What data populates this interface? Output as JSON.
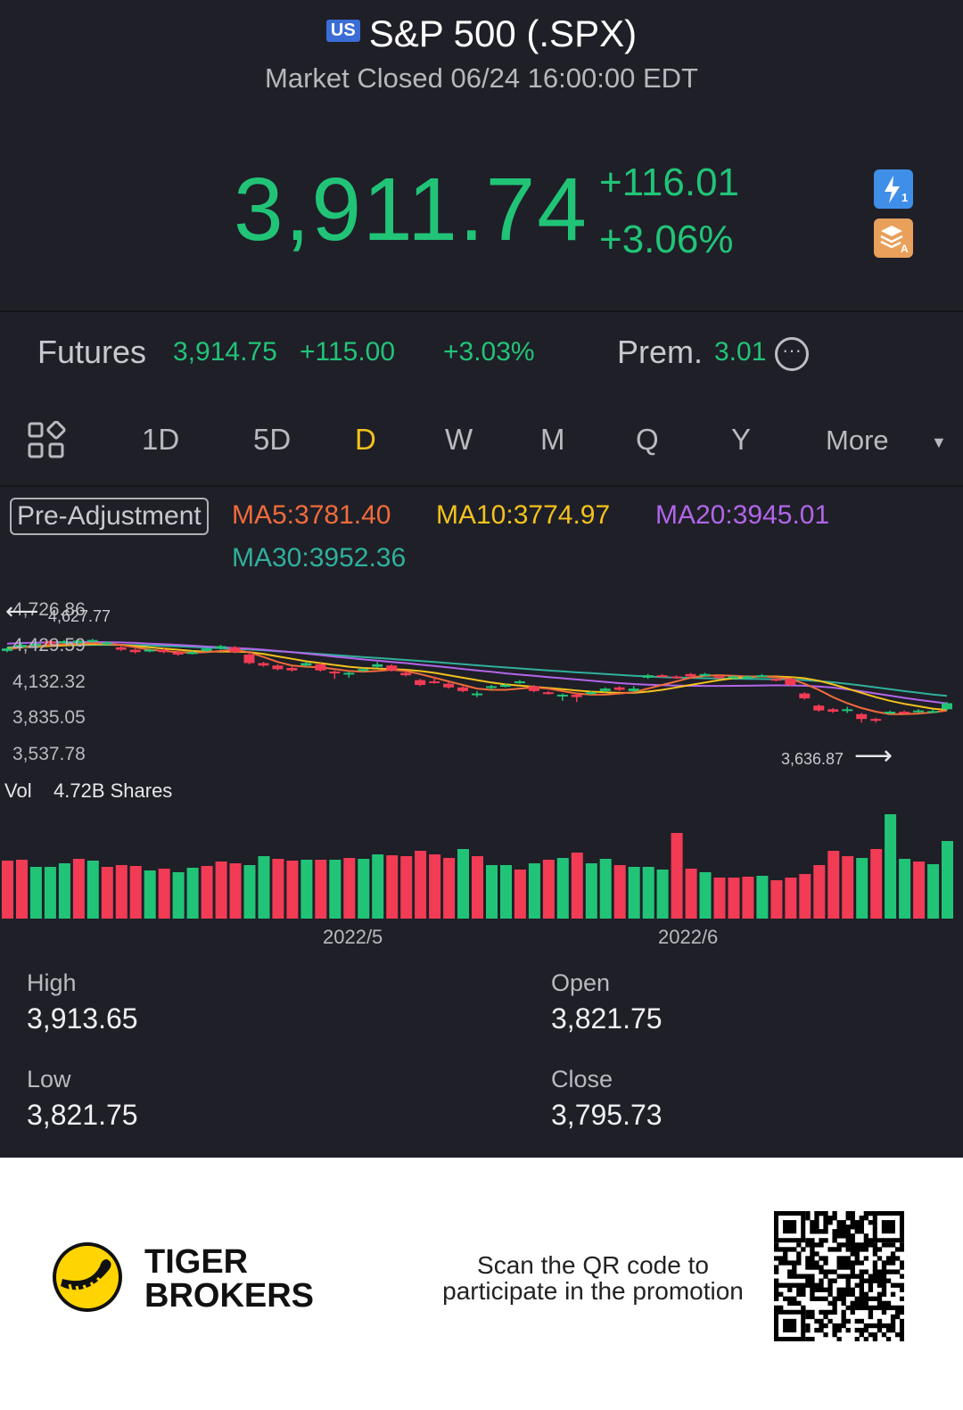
{
  "header": {
    "badge": "US",
    "title": "S&P 500 (.SPX)",
    "status": "Market Closed 06/24 16:00:00 EDT"
  },
  "quote": {
    "price": "3,911.74",
    "change": "+116.01",
    "change_pct": "+3.06%",
    "up_color": "#21c477",
    "down_color": "#f23b54"
  },
  "futures": {
    "label": "Futures",
    "price": "3,914.75",
    "change": "+115.00",
    "change_pct": "+3.03%",
    "prem_label": "Prem.",
    "prem_value": "3.01"
  },
  "tabs": {
    "items": [
      "1D",
      "5D",
      "D",
      "W",
      "M",
      "Q",
      "Y"
    ],
    "active": "D",
    "more_label": "More"
  },
  "indicators": {
    "adjust_label": "Pre-Adjustment",
    "ma5": "MA5:3781.40",
    "ma10": "MA10:3774.97",
    "ma20": "MA20:3945.01",
    "ma30": "MA30:3952.36"
  },
  "chart_data": {
    "type": "candlestick",
    "y_ticks": [
      "4,726.86",
      "4,429.59",
      "4,132.32",
      "3,835.05",
      "3,537.78"
    ],
    "max_annotation": "4,627.77",
    "min_annotation": "3,636.87",
    "x_ticks": [
      "2022/5",
      "2022/6"
    ],
    "volume_label": "Vol",
    "volume_value": "4.72B Shares",
    "candles": [
      {
        "o": 4390,
        "c": 4410,
        "h": 4420,
        "l": 4380
      },
      {
        "o": 4420,
        "c": 4440,
        "h": 4460,
        "l": 4410
      },
      {
        "o": 4430,
        "c": 4450,
        "h": 4460,
        "l": 4420
      },
      {
        "o": 4470,
        "c": 4450,
        "h": 4480,
        "l": 4440
      },
      {
        "o": 4460,
        "c": 4470,
        "h": 4480,
        "l": 4450
      },
      {
        "o": 4455,
        "c": 4475,
        "h": 4485,
        "l": 4445
      },
      {
        "o": 4470,
        "c": 4480,
        "h": 4490,
        "l": 4460
      },
      {
        "o": 4450,
        "c": 4460,
        "h": 4470,
        "l": 4440
      },
      {
        "o": 4420,
        "c": 4400,
        "h": 4430,
        "l": 4390
      },
      {
        "o": 4400,
        "c": 4380,
        "h": 4410,
        "l": 4370
      },
      {
        "o": 4390,
        "c": 4400,
        "h": 4410,
        "l": 4380
      },
      {
        "o": 4400,
        "c": 4380,
        "h": 4410,
        "l": 4370
      },
      {
        "o": 4380,
        "c": 4360,
        "h": 4395,
        "l": 4350
      },
      {
        "o": 4370,
        "c": 4380,
        "h": 4390,
        "l": 4360
      },
      {
        "o": 4390,
        "c": 4410,
        "h": 4420,
        "l": 4380
      },
      {
        "o": 4410,
        "c": 4430,
        "h": 4440,
        "l": 4400
      },
      {
        "o": 4420,
        "c": 4380,
        "h": 4430,
        "l": 4370
      },
      {
        "o": 4360,
        "c": 4290,
        "h": 4370,
        "l": 4280
      },
      {
        "o": 4290,
        "c": 4270,
        "h": 4300,
        "l": 4260
      },
      {
        "o": 4270,
        "c": 4240,
        "h": 4280,
        "l": 4230
      },
      {
        "o": 4250,
        "c": 4230,
        "h": 4260,
        "l": 4220
      },
      {
        "o": 4270,
        "c": 4290,
        "h": 4300,
        "l": 4260
      },
      {
        "o": 4280,
        "c": 4230,
        "h": 4290,
        "l": 4220
      },
      {
        "o": 4220,
        "c": 4210,
        "h": 4230,
        "l": 4160
      },
      {
        "o": 4200,
        "c": 4210,
        "h": 4220,
        "l": 4170
      },
      {
        "o": 4230,
        "c": 4240,
        "h": 4250,
        "l": 4220
      },
      {
        "o": 4260,
        "c": 4280,
        "h": 4300,
        "l": 4250
      },
      {
        "o": 4270,
        "c": 4230,
        "h": 4280,
        "l": 4220
      },
      {
        "o": 4210,
        "c": 4190,
        "h": 4220,
        "l": 4180
      },
      {
        "o": 4150,
        "c": 4110,
        "h": 4160,
        "l": 4100
      },
      {
        "o": 4140,
        "c": 4130,
        "h": 4180,
        "l": 4120
      },
      {
        "o": 4120,
        "c": 4090,
        "h": 4130,
        "l": 4080
      },
      {
        "o": 4090,
        "c": 4060,
        "h": 4100,
        "l": 4050
      },
      {
        "o": 4030,
        "c": 4040,
        "h": 4060,
        "l": 4010
      },
      {
        "o": 4090,
        "c": 4100,
        "h": 4110,
        "l": 4070
      },
      {
        "o": 4100,
        "c": 4110,
        "h": 4120,
        "l": 4090
      },
      {
        "o": 4130,
        "c": 4140,
        "h": 4150,
        "l": 4120
      },
      {
        "o": 4100,
        "c": 4060,
        "h": 4110,
        "l": 4050
      },
      {
        "o": 4050,
        "c": 4040,
        "h": 4060,
        "l": 4030
      },
      {
        "o": 4020,
        "c": 4030,
        "h": 4040,
        "l": 3980
      },
      {
        "o": 4030,
        "c": 4010,
        "h": 4040,
        "l": 3970
      },
      {
        "o": 4040,
        "c": 4050,
        "h": 4060,
        "l": 4030
      },
      {
        "o": 4060,
        "c": 4080,
        "h": 4090,
        "l": 4050
      },
      {
        "o": 4090,
        "c": 4070,
        "h": 4100,
        "l": 4060
      },
      {
        "o": 4060,
        "c": 4080,
        "h": 4100,
        "l": 4050
      },
      {
        "o": 4170,
        "c": 4190,
        "h": 4200,
        "l": 4160
      },
      {
        "o": 4190,
        "c": 4180,
        "h": 4200,
        "l": 4170
      },
      {
        "o": 4180,
        "c": 4170,
        "h": 4190,
        "l": 4160
      },
      {
        "o": 4200,
        "c": 4180,
        "h": 4210,
        "l": 4170
      },
      {
        "o": 4190,
        "c": 4200,
        "h": 4210,
        "l": 4180
      },
      {
        "o": 4180,
        "c": 4170,
        "h": 4190,
        "l": 4160
      },
      {
        "o": 4175,
        "c": 4180,
        "h": 4190,
        "l": 4160
      },
      {
        "o": 4170,
        "c": 4180,
        "h": 4190,
        "l": 4160
      },
      {
        "o": 4180,
        "c": 4190,
        "h": 4200,
        "l": 4170
      },
      {
        "o": 4160,
        "c": 4150,
        "h": 4170,
        "l": 4140
      },
      {
        "o": 4160,
        "c": 4110,
        "h": 4170,
        "l": 4100
      },
      {
        "o": 4040,
        "c": 4000,
        "h": 4050,
        "l": 3990
      },
      {
        "o": 3940,
        "c": 3900,
        "h": 3950,
        "l": 3890
      },
      {
        "o": 3910,
        "c": 3890,
        "h": 3920,
        "l": 3880
      },
      {
        "o": 3900,
        "c": 3910,
        "h": 3930,
        "l": 3880
      },
      {
        "o": 3870,
        "c": 3830,
        "h": 3880,
        "l": 3800
      },
      {
        "o": 3830,
        "c": 3820,
        "h": 3840,
        "l": 3800
      },
      {
        "o": 3880,
        "c": 3890,
        "h": 3900,
        "l": 3870
      },
      {
        "o": 3890,
        "c": 3880,
        "h": 3900,
        "l": 3870
      },
      {
        "o": 3890,
        "c": 3900,
        "h": 3910,
        "l": 3880
      },
      {
        "o": 3890,
        "c": 3895,
        "h": 3910,
        "l": 3880
      },
      {
        "o": 3910,
        "c": 3960,
        "h": 3970,
        "l": 3900
      }
    ],
    "ma5": [
      4400,
      4420,
      4430,
      4440,
      4445,
      4450,
      4455,
      4450,
      4440,
      4420,
      4400,
      4390,
      4380,
      4375,
      4380,
      4390,
      4400,
      4380,
      4340,
      4300,
      4270,
      4260,
      4255,
      4240,
      4225,
      4220,
      4225,
      4235,
      4225,
      4200,
      4170,
      4140,
      4110,
      4080,
      4070,
      4070,
      4080,
      4090,
      4080,
      4060,
      4040,
      4030,
      4030,
      4040,
      4050,
      4080,
      4110,
      4140,
      4170,
      4185,
      4190,
      4185,
      4180,
      4180,
      4175,
      4160,
      4120,
      4070,
      4010,
      3960,
      3920,
      3890,
      3870,
      3870,
      3875,
      3885,
      3900
    ],
    "ma10": [
      4410,
      4420,
      4425,
      4430,
      4435,
      4440,
      4445,
      4445,
      4440,
      4430,
      4420,
      4410,
      4400,
      4390,
      4385,
      4385,
      4385,
      4380,
      4365,
      4345,
      4325,
      4305,
      4290,
      4275,
      4260,
      4250,
      4245,
      4240,
      4235,
      4225,
      4210,
      4190,
      4170,
      4150,
      4130,
      4115,
      4105,
      4095,
      4085,
      4075,
      4065,
      4055,
      4050,
      4045,
      4045,
      4055,
      4070,
      4090,
      4110,
      4130,
      4150,
      4165,
      4175,
      4180,
      4180,
      4175,
      4165,
      4145,
      4115,
      4080,
      4045,
      4010,
      3980,
      3955,
      3935,
      3915,
      3905
    ],
    "ma20": [
      4450,
      4455,
      4458,
      4460,
      4462,
      4463,
      4463,
      4462,
      4460,
      4456,
      4450,
      4445,
      4440,
      4433,
      4426,
      4420,
      4414,
      4408,
      4400,
      4390,
      4380,
      4368,
      4356,
      4344,
      4332,
      4320,
      4310,
      4300,
      4290,
      4278,
      4266,
      4254,
      4242,
      4230,
      4218,
      4206,
      4195,
      4185,
      4175,
      4165,
      4155,
      4145,
      4135,
      4125,
      4118,
      4112,
      4108,
      4105,
      4103,
      4102,
      4102,
      4103,
      4104,
      4106,
      4107,
      4106,
      4104,
      4098,
      4088,
      4074,
      4058,
      4040,
      4022,
      4004,
      3988,
      3972,
      3958
    ],
    "ma30": [
      4420,
      4425,
      4430,
      4433,
      4436,
      4438,
      4440,
      4440,
      4440,
      4438,
      4436,
      4432,
      4428,
      4423,
      4418,
      4413,
      4408,
      4402,
      4396,
      4388,
      4380,
      4372,
      4364,
      4356,
      4348,
      4340,
      4332,
      4324,
      4316,
      4308,
      4299,
      4290,
      4281,
      4272,
      4263,
      4254,
      4246,
      4238,
      4230,
      4222,
      4214,
      4207,
      4200,
      4193,
      4186,
      4180,
      4175,
      4171,
      4168,
      4165,
      4163,
      4161,
      4160,
      4159,
      4157,
      4155,
      4150,
      4142,
      4132,
      4120,
      4106,
      4090,
      4075,
      4060,
      4046,
      4032,
      4020
    ],
    "volumes": [
      {
        "v": 65,
        "up": false
      },
      {
        "v": 66,
        "up": false
      },
      {
        "v": 58,
        "up": true
      },
      {
        "v": 58,
        "up": true
      },
      {
        "v": 62,
        "up": true
      },
      {
        "v": 67,
        "up": false
      },
      {
        "v": 65,
        "up": true
      },
      {
        "v": 58,
        "up": false
      },
      {
        "v": 60,
        "up": false
      },
      {
        "v": 59,
        "up": false
      },
      {
        "v": 54,
        "up": true
      },
      {
        "v": 56,
        "up": false
      },
      {
        "v": 52,
        "up": true
      },
      {
        "v": 57,
        "up": true
      },
      {
        "v": 59,
        "up": false
      },
      {
        "v": 64,
        "up": false
      },
      {
        "v": 62,
        "up": false
      },
      {
        "v": 60,
        "up": true
      },
      {
        "v": 70,
        "up": true
      },
      {
        "v": 67,
        "up": false
      },
      {
        "v": 65,
        "up": false
      },
      {
        "v": 66,
        "up": true
      },
      {
        "v": 66,
        "up": false
      },
      {
        "v": 66,
        "up": true
      },
      {
        "v": 68,
        "up": false
      },
      {
        "v": 67,
        "up": true
      },
      {
        "v": 72,
        "up": true
      },
      {
        "v": 71,
        "up": false
      },
      {
        "v": 70,
        "up": false
      },
      {
        "v": 76,
        "up": false
      },
      {
        "v": 72,
        "up": false
      },
      {
        "v": 68,
        "up": false
      },
      {
        "v": 78,
        "up": true
      },
      {
        "v": 70,
        "up": false
      },
      {
        "v": 60,
        "up": true
      },
      {
        "v": 60,
        "up": true
      },
      {
        "v": 55,
        "up": false
      },
      {
        "v": 62,
        "up": true
      },
      {
        "v": 66,
        "up": false
      },
      {
        "v": 68,
        "up": true
      },
      {
        "v": 74,
        "up": false
      },
      {
        "v": 62,
        "up": true
      },
      {
        "v": 67,
        "up": true
      },
      {
        "v": 60,
        "up": false
      },
      {
        "v": 58,
        "up": true
      },
      {
        "v": 58,
        "up": true
      },
      {
        "v": 55,
        "up": true
      },
      {
        "v": 96,
        "up": false
      },
      {
        "v": 56,
        "up": false
      },
      {
        "v": 52,
        "up": true
      },
      {
        "v": 46,
        "up": false
      },
      {
        "v": 46,
        "up": false
      },
      {
        "v": 47,
        "up": false
      },
      {
        "v": 48,
        "up": true
      },
      {
        "v": 43,
        "up": false
      },
      {
        "v": 46,
        "up": false
      },
      {
        "v": 50,
        "up": false
      },
      {
        "v": 60,
        "up": false
      },
      {
        "v": 76,
        "up": false
      },
      {
        "v": 70,
        "up": false
      },
      {
        "v": 68,
        "up": true
      },
      {
        "v": 78,
        "up": false
      },
      {
        "v": 117,
        "up": true
      },
      {
        "v": 67,
        "up": true
      },
      {
        "v": 64,
        "up": false
      },
      {
        "v": 61,
        "up": true
      },
      {
        "v": 87,
        "up": true
      }
    ]
  },
  "ohlc": {
    "high_label": "High",
    "high_value": "3,913.65",
    "open_label": "Open",
    "open_value": "3,821.75",
    "low_label": "Low",
    "low_value": "3,821.75",
    "close_label": "Close",
    "close_value": "3,795.73"
  },
  "footer": {
    "brand_line1": "TIGER",
    "brand_line2": "BROKERS",
    "promo_line1": "Scan the QR code to",
    "promo_line2": "participate in the promotion"
  }
}
